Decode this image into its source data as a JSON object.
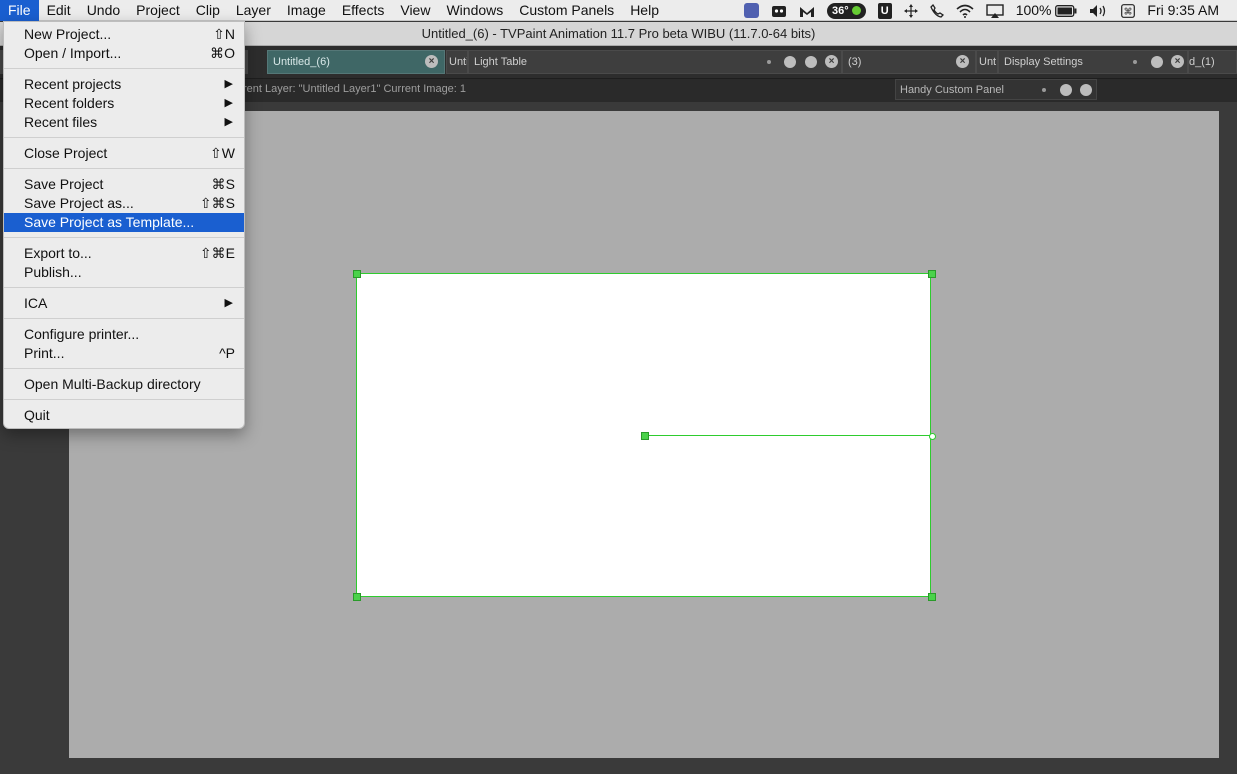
{
  "menubar": {
    "items": [
      "File",
      "Edit",
      "Undo",
      "Project",
      "Clip",
      "Layer",
      "Image",
      "Effects",
      "View",
      "Windows",
      "Custom Panels",
      "Help"
    ],
    "active": "File",
    "tray": {
      "temperature": "36°",
      "battery": "100%",
      "clock": "Fri 9:35 AM"
    }
  },
  "window": {
    "title": "Untitled_(6) - TVPaint Animation 11.7 Pro beta WIBU (11.7.0-64 bits)"
  },
  "tabs": {
    "doc_tab": "Untitled_(6)",
    "unti_1": "Unti",
    "light_table": "Light Table",
    "tab_3": "(3)",
    "unti_2": "Unt",
    "display_settings": "Display Settings",
    "tab_1": "d_(1)"
  },
  "status": {
    "text": "rent Layer: \"Untitled Layer1\"   Current Image: 1",
    "handy_panel": "Handy Custom Panel"
  },
  "filemenu": {
    "items": [
      {
        "label": "New Project...",
        "shortcut": "⇧N"
      },
      {
        "label": "Open / Import...",
        "shortcut": "⌘O"
      },
      {
        "label": "Recent projects",
        "submenu": true
      },
      {
        "label": "Recent folders",
        "submenu": true
      },
      {
        "label": "Recent files",
        "submenu": true
      },
      {
        "label": "Close Project",
        "shortcut": "⇧W"
      },
      {
        "label": "Save Project",
        "shortcut": "⌘S"
      },
      {
        "label": "Save Project as...",
        "shortcut": "⇧⌘S"
      },
      {
        "label": "Save Project as Template...",
        "shortcut": "",
        "highlighted": true
      },
      {
        "label": "Export to...",
        "shortcut": "⇧⌘E"
      },
      {
        "label": "Publish...",
        "shortcut": ""
      },
      {
        "label": "ICA",
        "submenu": true
      },
      {
        "label": "Configure printer...",
        "shortcut": ""
      },
      {
        "label": "Print...",
        "shortcut": "^P"
      },
      {
        "label": "Open Multi-Backup directory",
        "shortcut": ""
      },
      {
        "label": "Quit",
        "shortcut": ""
      }
    ]
  },
  "colors": {
    "menu_highlight": "#1a5fd0",
    "workspace_bg": "#acacac",
    "canvas_border": "#2ecc2e",
    "doc_tab": "#3f6766"
  }
}
